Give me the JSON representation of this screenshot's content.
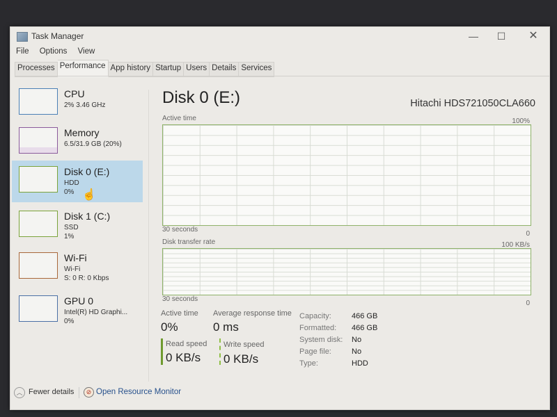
{
  "window": {
    "title": "Task Manager",
    "controls": {
      "minimize": "—",
      "maximize": "☐",
      "close": "✕"
    }
  },
  "menu": [
    "File",
    "Options",
    "View"
  ],
  "tabs": [
    {
      "label": "Processes"
    },
    {
      "label": "Performance",
      "active": true
    },
    {
      "label": "App history"
    },
    {
      "label": "Startup"
    },
    {
      "label": "Users"
    },
    {
      "label": "Details"
    },
    {
      "label": "Services"
    }
  ],
  "sidebar": {
    "items": [
      {
        "name": "CPU",
        "line1": "2%  3.46 GHz",
        "line2": "",
        "color": "#4a7fb5"
      },
      {
        "name": "Memory",
        "line1": "6.5/31.9 GB (20%)",
        "line2": "",
        "color": "#8b5a9b"
      },
      {
        "name": "Disk 0 (E:)",
        "line1": "HDD",
        "line2": "0%",
        "color": "#7aa33a",
        "selected": true
      },
      {
        "name": "Disk 1 (C:)",
        "line1": "SSD",
        "line2": "1%",
        "color": "#7aa33a"
      },
      {
        "name": "Wi-Fi",
        "line1": "Wi-Fi",
        "line2": "S: 0  R: 0 Kbps",
        "color": "#a8673a"
      },
      {
        "name": "GPU 0",
        "line1": "Intel(R) HD Graphi...",
        "line2": "0%",
        "color": "#4a6fa5"
      }
    ]
  },
  "main": {
    "title": "Disk 0 (E:)",
    "model": "Hitachi HDS721050CLA660",
    "active_time_graph": {
      "label": "Active time",
      "max": "100%",
      "time_span": "30 seconds",
      "min": "0"
    },
    "transfer_graph": {
      "label": "Disk transfer rate",
      "max": "100 KB/s",
      "time_span": "30 seconds",
      "min": "0"
    },
    "stats": {
      "active_time_label": "Active time",
      "active_time_value": "0%",
      "avg_response_label": "Average response time",
      "avg_response_value": "0 ms",
      "read_speed_label": "Read speed",
      "read_speed_value": "0 KB/s",
      "write_speed_label": "Write speed",
      "write_speed_value": "0 KB/s"
    },
    "properties": [
      {
        "label": "Capacity:",
        "value": "466 GB"
      },
      {
        "label": "Formatted:",
        "value": "466 GB"
      },
      {
        "label": "System disk:",
        "value": "No"
      },
      {
        "label": "Page file:",
        "value": "No"
      },
      {
        "label": "Type:",
        "value": "HDD"
      }
    ]
  },
  "footer": {
    "fewer_details": "Fewer details",
    "open_resource_monitor": "Open Resource Monitor"
  }
}
